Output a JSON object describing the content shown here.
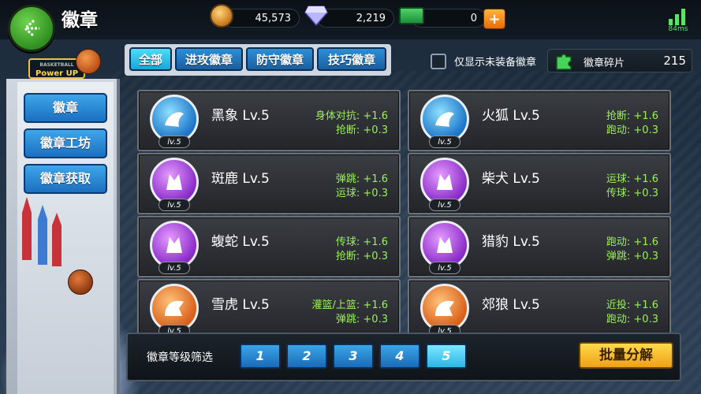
{
  "header": {
    "title": "徽章",
    "coins": "45,573",
    "gems": "2,219",
    "cash": "0",
    "ping": "84ms"
  },
  "sidebar": {
    "logo_small": "BASKETBALL",
    "logo": "Power UP",
    "items": [
      {
        "label": "徽章"
      },
      {
        "label": "徽章工坊"
      },
      {
        "label": "徽章获取"
      }
    ]
  },
  "tabs": [
    {
      "label": "全部",
      "active": true
    },
    {
      "label": "进攻徽章"
    },
    {
      "label": "防守徽章"
    },
    {
      "label": "技巧徽章"
    }
  ],
  "filter_unequipped_label": "仅显示未装备徽章",
  "fragments": {
    "label": "徽章碎片",
    "value": "215"
  },
  "badges": [
    {
      "name": "黑象 Lv.5",
      "level_tag": "lv.5",
      "color": "blue",
      "stats": [
        "身体对抗: +1.6",
        "抢断: +0.3"
      ]
    },
    {
      "name": "火狐 Lv.5",
      "level_tag": "lv.5",
      "color": "blue",
      "stats": [
        "抢断: +1.6",
        "跑动: +0.3"
      ]
    },
    {
      "name": "斑鹿 Lv.5",
      "level_tag": "lv.5",
      "color": "purple",
      "stats": [
        "弹跳: +1.6",
        "运球: +0.3"
      ]
    },
    {
      "name": "柴犬 Lv.5",
      "level_tag": "lv.5",
      "color": "purple",
      "stats": [
        "运球: +1.6",
        "传球: +0.3"
      ]
    },
    {
      "name": "蝮蛇 Lv.5",
      "level_tag": "lv.5",
      "color": "purple",
      "stats": [
        "传球: +1.6",
        "抢断: +0.3"
      ]
    },
    {
      "name": "猎豹 Lv.5",
      "level_tag": "lv.5",
      "color": "purple",
      "stats": [
        "跑动: +1.6",
        "弹跳: +0.3"
      ]
    },
    {
      "name": "雪虎 Lv.5",
      "level_tag": "lv.5",
      "color": "orange",
      "stats": [
        "灌篮/上篮: +1.6",
        "弹跳: +0.3"
      ]
    },
    {
      "name": "郊狼 Lv.5",
      "level_tag": "lv.5",
      "color": "orange",
      "stats": [
        "近投: +1.6",
        "跑动: +0.3"
      ]
    }
  ],
  "level_filter": {
    "label": "徽章等级筛选",
    "levels": [
      "1",
      "2",
      "3",
      "4",
      "5"
    ],
    "selected": "5"
  },
  "bulk_button": "批量分解"
}
